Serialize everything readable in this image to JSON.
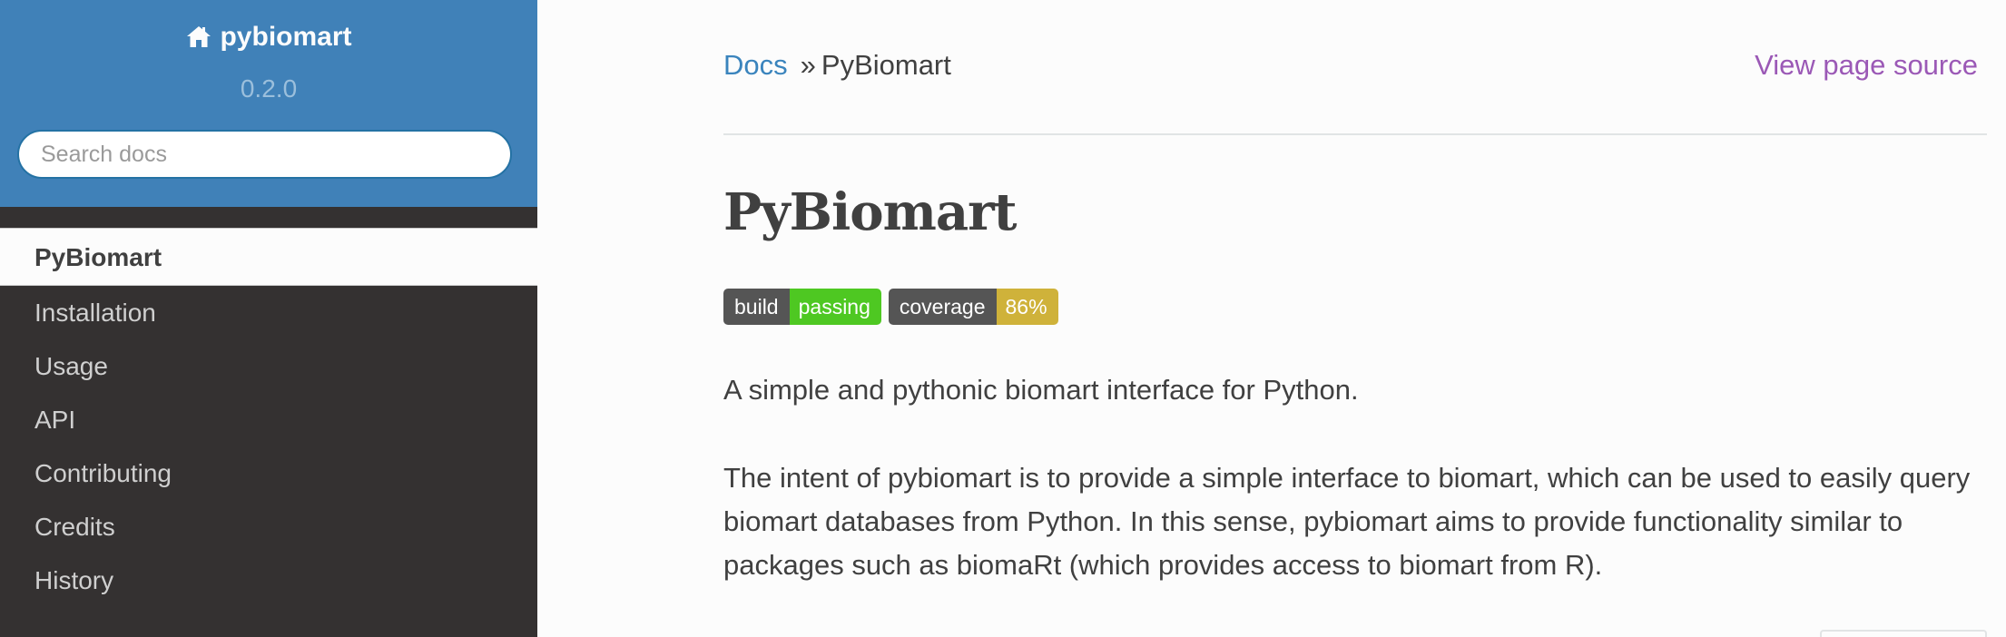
{
  "sidebar": {
    "project_name": "pybiomart",
    "version": "0.2.0",
    "search_placeholder": "Search docs",
    "items": [
      {
        "label": "PyBiomart",
        "current": true
      },
      {
        "label": "Installation"
      },
      {
        "label": "Usage"
      },
      {
        "label": "API"
      },
      {
        "label": "Contributing"
      },
      {
        "label": "Credits"
      },
      {
        "label": "History"
      }
    ]
  },
  "breadcrumb": {
    "home": "Docs",
    "separator": "»",
    "current": "PyBiomart",
    "view_source": "View page source"
  },
  "main": {
    "title": "PyBiomart",
    "badges": [
      {
        "label": "build",
        "value": "passing",
        "color": "#4ec822"
      },
      {
        "label": "coverage",
        "value": "86%",
        "color": "#cfb23a"
      }
    ],
    "paragraph1": "A simple and pythonic biomart interface for Python.",
    "paragraph2": "The intent of pybiomart is to provide a simple interface to biomart, which can be used to easily query biomart databases from Python. In this sense, pybiomart aims to provide functionality similar to packages such as biomaRt (which provides access to biomart from R)."
  },
  "colors": {
    "sidebar_header": "#4081b8",
    "sidebar_bg": "#343131",
    "link": "#3a84bd",
    "visited_link": "#9b59b6",
    "text": "#404040"
  }
}
